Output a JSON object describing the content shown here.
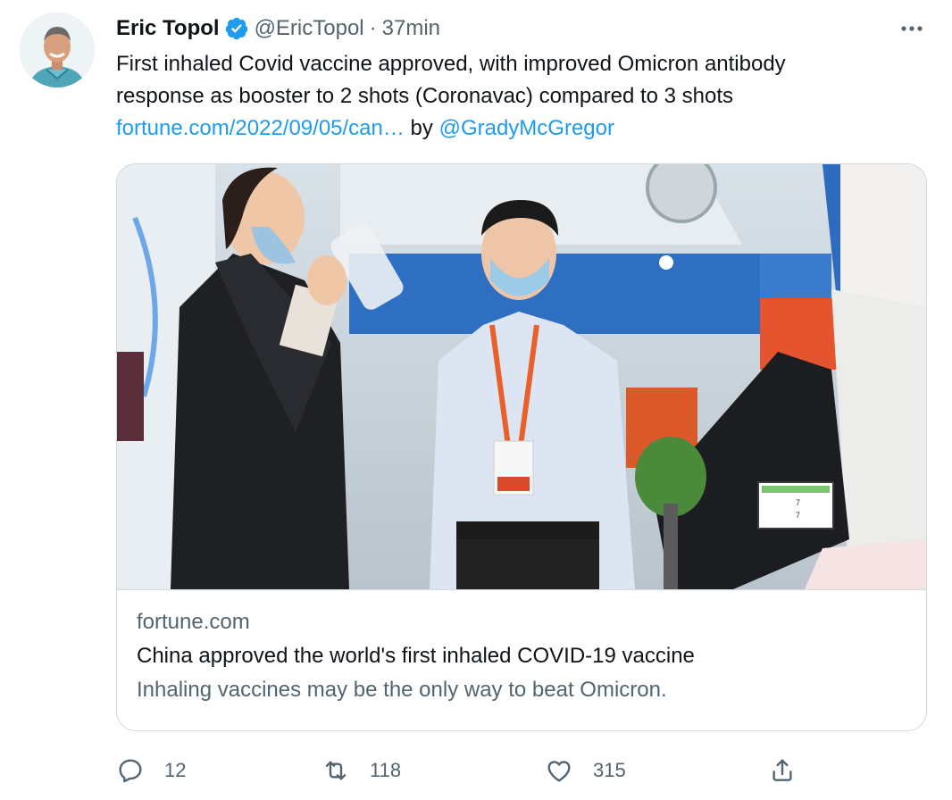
{
  "author": {
    "name": "Eric Topol",
    "handle": "@EricTopol",
    "separator": "·",
    "time": "37min",
    "verified_color": "#1d9bf0"
  },
  "tweet": {
    "line1": "First inhaled Covid vaccine approved, with improved Omicron antibody",
    "line2": "response as booster to 2 shots (Coronavac) compared to 3 shots",
    "link_text": "fortune.com/2022/09/05/can…",
    "by_text": "by",
    "mention": "@GradyMcGregor"
  },
  "card": {
    "domain": "fortune.com",
    "title": "China approved the world's first inhaled COVID-19 vaccine",
    "description": "Inhaling vaccines may be the only way to beat Omicron.",
    "sign_number": "7"
  },
  "actions": {
    "reply_count": "12",
    "retweet_count": "118",
    "like_count": "315",
    "icons": [
      "reply-icon",
      "retweet-icon",
      "like-icon",
      "share-icon"
    ]
  },
  "colors": {
    "accent": "#1d9bf0",
    "secondary_text": "#536471",
    "border": "#cfd9de"
  }
}
